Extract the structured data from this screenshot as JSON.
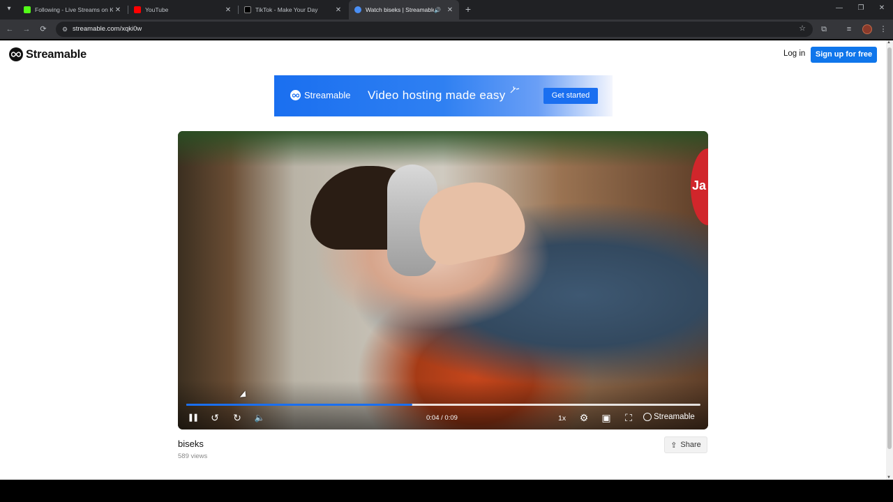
{
  "browser": {
    "tabs": [
      {
        "title": "Following - Live Streams on Kic",
        "favicon_color": "#53fc18",
        "active": false
      },
      {
        "title": "YouTube",
        "favicon_color": "#ff0000",
        "active": false
      },
      {
        "title": "TikTok - Make Your Day",
        "favicon_color": "#000000",
        "active": false
      },
      {
        "title": "Watch biseks | Streamable",
        "favicon_color": "#4a8ff5",
        "active": true
      }
    ],
    "url": "streamable.com/xqki0w",
    "icons": {
      "tab_list": "▾",
      "close": "✕",
      "new_tab": "+",
      "speaker": "🔊",
      "minimize": "—",
      "restore": "❐",
      "window_close": "✕",
      "back": "←",
      "forward": "→",
      "reload": "⟳",
      "site_info": "⚙",
      "bookmark": "☆",
      "extensions": "⧉",
      "media": "≡",
      "menu": "⋮"
    }
  },
  "header": {
    "brand": "Streamable",
    "login": "Log in",
    "signup": "Sign up for free"
  },
  "ad": {
    "brand": "Streamable",
    "tagline": "Video hosting made easy",
    "cta": "Get started"
  },
  "player": {
    "badge_text": "Ja",
    "time": "0:04 / 0:09",
    "progress": 0.44,
    "speed": "1x",
    "watermark": "Streamable",
    "icons": {
      "pause": "❚❚",
      "rewind": "↺",
      "forward": "↻",
      "volume": "🔈",
      "settings": "⚙",
      "pip": "▣",
      "fullscreen": "⛶"
    }
  },
  "video": {
    "title": "biseks",
    "views": "589 views",
    "share": "Share",
    "share_icon": "⇪"
  }
}
